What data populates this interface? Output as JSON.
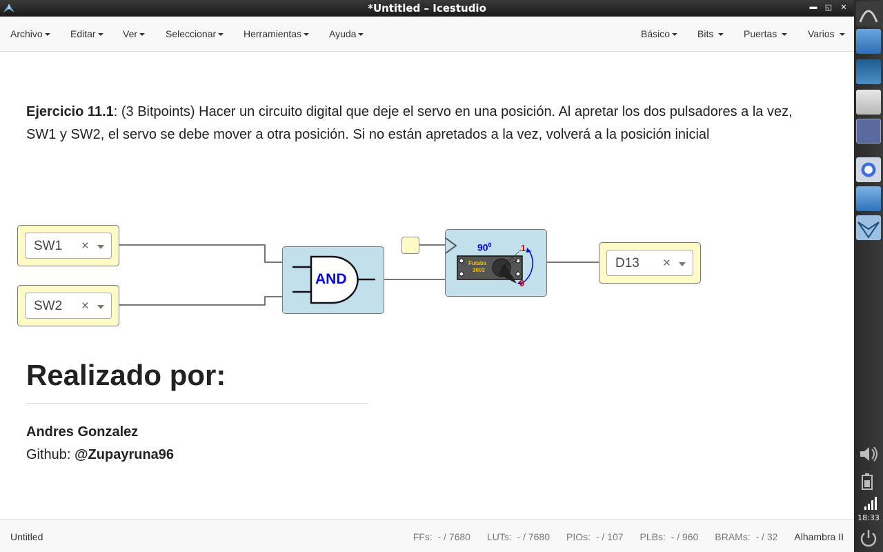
{
  "window": {
    "title": "*Untitled – Icestudio"
  },
  "menubar": {
    "left": [
      {
        "label": "Archivo"
      },
      {
        "label": "Editar"
      },
      {
        "label": "Ver"
      },
      {
        "label": "Seleccionar"
      },
      {
        "label": "Herramientas"
      },
      {
        "label": "Ayuda"
      }
    ],
    "right": [
      {
        "label": "Básico"
      },
      {
        "label": "Bits"
      },
      {
        "label": "Puertas"
      },
      {
        "label": "Varios"
      }
    ]
  },
  "exercise": {
    "title": "Ejercicio 11.1",
    "text": ": (3 Bitpoints) Hacer un circuito digital que deje el servo en una posición. Al apretar los dos pulsadores a la vez, SW1 y SW2, el servo se debe mover a otra posición. Si no están apretados a la vez, volverá a la posición inicial"
  },
  "circuit": {
    "inputs": [
      {
        "label": "SW1"
      },
      {
        "label": "SW2"
      }
    ],
    "gate": {
      "label": "AND"
    },
    "servo": {
      "angle": "90",
      "degree": "0",
      "pos1": "1",
      "pos0": "0",
      "brand": "Futaba",
      "model": "3003"
    },
    "output": {
      "label": "D13"
    },
    "clear_glyph": "×"
  },
  "author_section": {
    "heading": "Realizado por:",
    "name": "Andres Gonzalez",
    "github_label": "Github: ",
    "github_handle": "@Zupayruna96"
  },
  "statusbar": {
    "filename": "Untitled",
    "ffs_label": "FFs:",
    "ffs_value": "- / 7680",
    "luts_label": "LUTs:",
    "luts_value": "- / 7680",
    "pios_label": "PIOs:",
    "pios_value": "- / 107",
    "plbs_label": "PLBs:",
    "plbs_value": "- / 960",
    "brams_label": "BRAMs:",
    "brams_value": "- / 32",
    "board": "Alhambra II"
  },
  "system": {
    "clock": "18:33"
  },
  "colors": {
    "input_block": "#fffbc7",
    "logic_block": "#c2dfec",
    "wire": "#777777",
    "and_label": "#0000ee"
  }
}
